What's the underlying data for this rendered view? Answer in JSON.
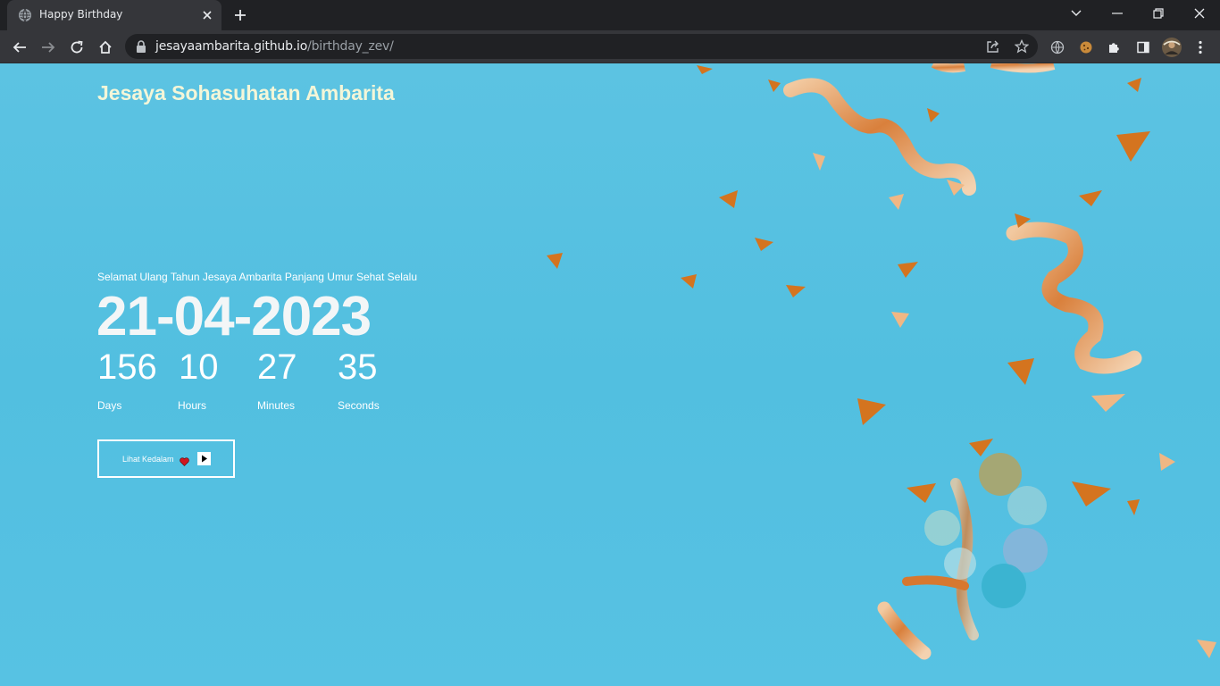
{
  "browser": {
    "tab_title": "Happy Birthday",
    "url_host": "jesayaambarita.github.io",
    "url_path": "/birthday_zev/"
  },
  "page": {
    "site_name": "Jesaya Sohasuhatan Ambarita",
    "greeting": "Selamat Ulang Tahun Jesaya Ambarita Panjang Umur Sehat Selalu",
    "date": "21-04-2023",
    "countdown": {
      "days": {
        "value": "156",
        "label": "Days"
      },
      "hours": {
        "value": "10",
        "label": "Hours"
      },
      "minutes": {
        "value": "27",
        "label": "Minutes"
      },
      "seconds": {
        "value": "35",
        "label": "Seconds"
      }
    },
    "cta_label": "Lihat Kedalam"
  },
  "colors": {
    "background": "#56c1e1",
    "site_name": "#f4f6d8",
    "text": "#ffffff",
    "heart": "#d0161f"
  },
  "icons": {
    "favicon": "globe-icon",
    "cta_heart": "heart-icon",
    "cta_play": "play-icon"
  }
}
